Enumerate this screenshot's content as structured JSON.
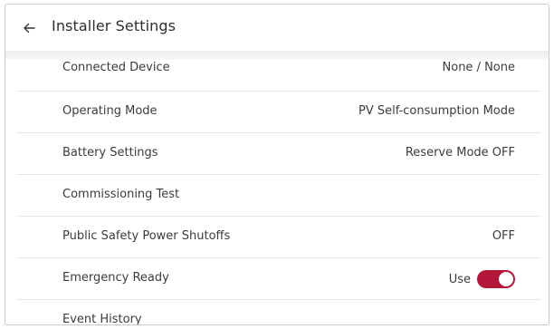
{
  "header": {
    "title": "Installer Settings",
    "back_icon": "arrow-left-icon"
  },
  "settings": [
    {
      "label": "Connected Device",
      "value": "None / None"
    },
    {
      "label": "Operating Mode",
      "value": "PV Self-consumption Mode"
    },
    {
      "label": "Battery Settings",
      "value": "Reserve Mode OFF"
    },
    {
      "label": "Commissioning Test",
      "value": ""
    },
    {
      "label": "Public Safety Power Shutoffs",
      "value": "OFF"
    },
    {
      "label": "Emergency Ready",
      "toggle_label": "Use",
      "toggle_on": true
    },
    {
      "label": "Event History",
      "value": ""
    }
  ],
  "colors": {
    "toggle_on": "#b3183a",
    "text": "#3b3b3b",
    "divider": "#e6e6e6"
  }
}
